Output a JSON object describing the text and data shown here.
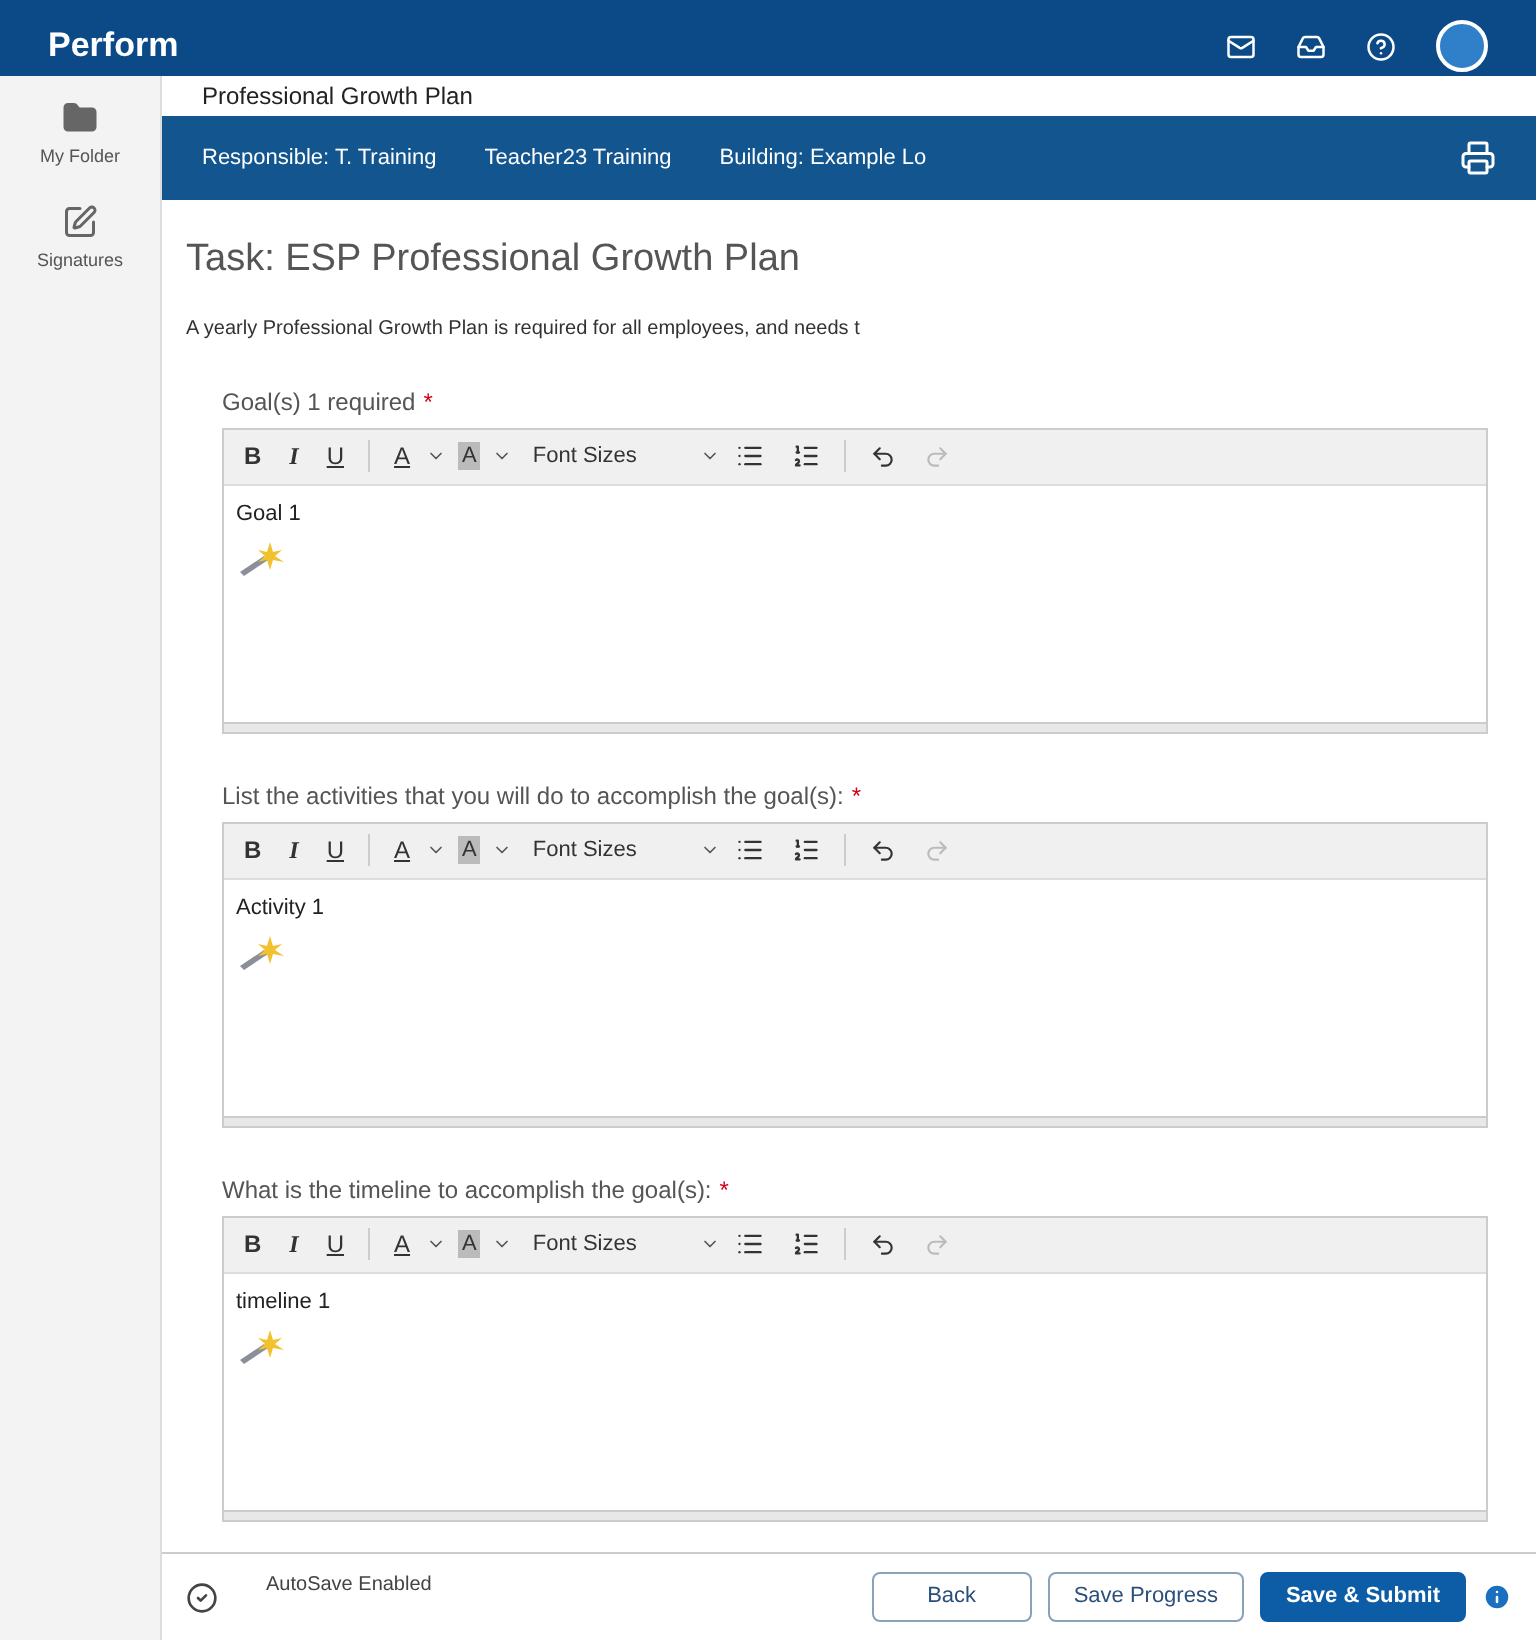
{
  "app": {
    "title": "Perform"
  },
  "sidebar": {
    "items": [
      {
        "label": "My Folder",
        "kind": "folder"
      },
      {
        "label": "Signatures",
        "kind": "sign"
      }
    ]
  },
  "plan": {
    "title": "Professional Growth Plan",
    "info": [
      "Responsible: T. Training",
      "Teacher23 Training",
      "Building: Example Lo"
    ]
  },
  "task": {
    "title": "Task: ESP Professional Growth Plan",
    "description": "A yearly Professional Growth Plan is required for all employees, and needs t"
  },
  "fields": [
    {
      "label": "Goal(s) 1 required",
      "required": true,
      "required_mark": "*",
      "content": "Goal 1",
      "toolbar": {
        "bold": "B",
        "italic": "I",
        "underline": "U",
        "text_color": "A",
        "background_color": "A",
        "font_sizes": "Font Sizes"
      }
    },
    {
      "label": "List the activities that you will do to accomplish the goal(s):",
      "required": true,
      "required_mark": "*",
      "content": "Activity 1",
      "toolbar": {
        "bold": "B",
        "italic": "I",
        "underline": "U",
        "text_color": "A",
        "background_color": "A",
        "font_sizes": "Font Sizes"
      }
    },
    {
      "label": "What is the timeline to accomplish the goal(s):",
      "required": true,
      "required_mark": "*",
      "content": "timeline 1",
      "toolbar": {
        "bold": "B",
        "italic": "I",
        "underline": "U",
        "text_color": "A",
        "background_color": "A",
        "font_sizes": "Font Sizes"
      }
    }
  ],
  "footer": {
    "autosave": "AutoSave Enabled",
    "buttons": [
      {
        "label": "Back",
        "kind": "secondary"
      },
      {
        "label": "Save Progress",
        "kind": "secondary"
      },
      {
        "label": "Save & Submit",
        "kind": "primary"
      }
    ]
  }
}
